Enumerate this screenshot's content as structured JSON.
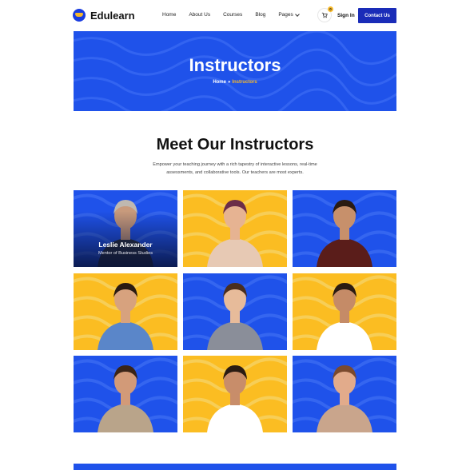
{
  "header": {
    "logo_text": "Edulearn",
    "nav": [
      "Home",
      "About Us",
      "Courses",
      "Blog",
      "Pages"
    ],
    "cart_count": "0",
    "signin_label": "Sign In",
    "contact_label": "Contact Us"
  },
  "hero": {
    "title": "Instructors",
    "breadcrumb_home": "Home",
    "breadcrumb_sep": "»",
    "breadcrumb_current": "Instructors"
  },
  "section": {
    "title": "Meet Our Instructors",
    "description": "Empower your teaching journey with a rich tapestry of interactive lessons, real-time assessments, and collaborative tools. Our teachers are most experts."
  },
  "instructors": [
    {
      "name": "Leslie Alexander",
      "role": "Mentor of Business Studies",
      "bg": "blue"
    },
    {
      "bg": "yellow"
    },
    {
      "bg": "blue"
    },
    {
      "bg": "yellow"
    },
    {
      "bg": "blue"
    },
    {
      "bg": "yellow"
    },
    {
      "bg": "blue"
    },
    {
      "bg": "yellow"
    },
    {
      "bg": "blue"
    }
  ],
  "colors": {
    "primary": "#1f52ea",
    "accent": "#f6b92b",
    "button": "#1a2cb8"
  }
}
